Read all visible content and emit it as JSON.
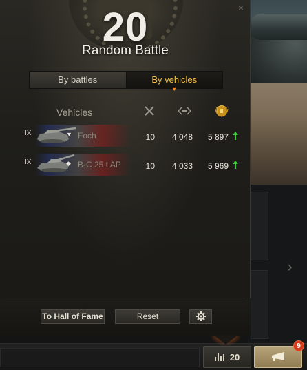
{
  "header": {
    "count": "20",
    "mode_title": "Random Battle",
    "close_icon": "close-icon"
  },
  "tabs": [
    {
      "label": "By battles",
      "active": false
    },
    {
      "label": "By vehicles",
      "active": true
    }
  ],
  "table": {
    "vehicles_header": "Vehicles",
    "column_icons": [
      "battles-icon",
      "experience-icon",
      "rating-icon"
    ],
    "rows": [
      {
        "tier": "IX",
        "type_icon": "heavy-tank-icon",
        "type_glyph": "▼",
        "name": "Foch",
        "battles": "10",
        "experience": "4 048",
        "rating": "5 897",
        "trend": "up"
      },
      {
        "tier": "IX",
        "type_icon": "tank-destroyer-icon",
        "type_glyph": "◆",
        "name": "B-C 25 t AP",
        "battles": "10",
        "experience": "4 033",
        "rating": "5 969",
        "trend": "up"
      }
    ]
  },
  "footer": {
    "hall_of_fame": "To Hall of Fame",
    "reset": "Reset",
    "settings_icon": "gear-icon"
  },
  "bottom_bar": {
    "stats_count": "20",
    "notifications_badge": "9"
  },
  "colors": {
    "accent": "#f5c040",
    "trend_up": "#3ecf3e",
    "badge": "#d23a1a"
  }
}
